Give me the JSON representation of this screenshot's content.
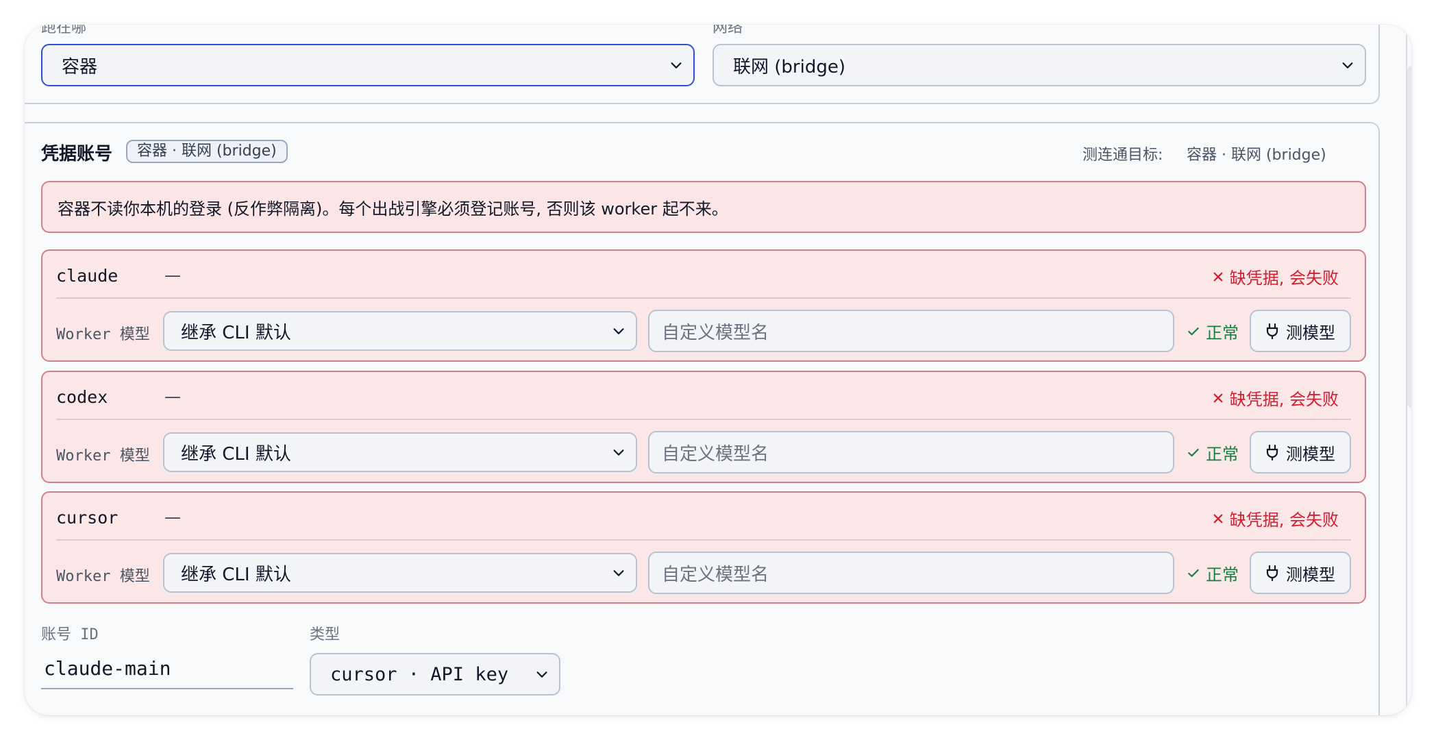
{
  "top_section": {
    "run_location_label": "跑在哪",
    "run_location_value": "容器",
    "network_label": "网络",
    "network_value": "联网 (bridge)"
  },
  "credentials": {
    "title": "凭据账号",
    "badge": "容器 · 联网 (bridge)",
    "target_label": "测连通目标:",
    "target_value": "容器 · 联网 (bridge)",
    "warning": "容器不读你本机的登录 (反作弊隔离)。每个出战引擎必须登记账号, 否则该 worker 起不来。",
    "engines": [
      {
        "name": "claude",
        "account": "—",
        "status": "缺凭据, 会失败",
        "worker_label": "Worker 模型",
        "model_select": "继承 CLI 默认",
        "custom_placeholder": "自定义模型名",
        "ok_text": "正常",
        "test_button": "测模型"
      },
      {
        "name": "codex",
        "account": "—",
        "status": "缺凭据, 会失败",
        "worker_label": "Worker 模型",
        "model_select": "继承 CLI 默认",
        "custom_placeholder": "自定义模型名",
        "ok_text": "正常",
        "test_button": "测模型"
      },
      {
        "name": "cursor",
        "account": "—",
        "status": "缺凭据, 会失败",
        "worker_label": "Worker 模型",
        "model_select": "继承 CLI 默认",
        "custom_placeholder": "自定义模型名",
        "ok_text": "正常",
        "test_button": "测模型"
      }
    ],
    "account_id_label": "账号 ID",
    "account_id_value": "claude-main",
    "type_label": "类型",
    "type_value": "cursor · API key"
  },
  "colors": {
    "accent": "#2b4fd6",
    "error": "#d21f2f",
    "ok": "#15803d",
    "warn_bg": "#fbe5e7"
  }
}
